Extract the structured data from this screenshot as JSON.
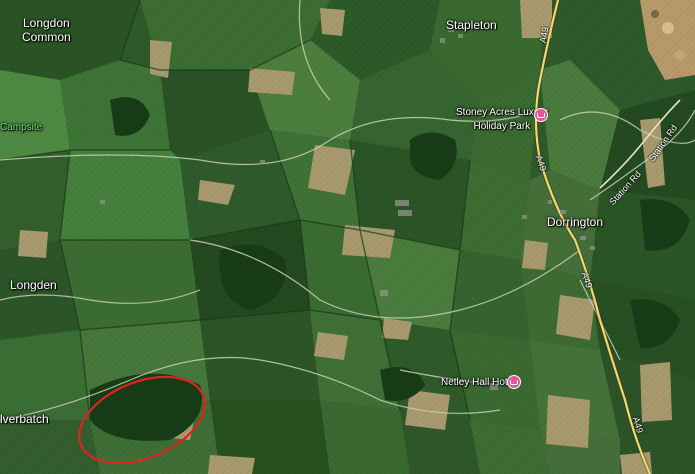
{
  "map": {
    "places": {
      "longdon_line1": "Longdon",
      "longdon_line2": "Common",
      "stapleton": "Stapleton",
      "dorrington": "Dorrington",
      "condover": "Longden",
      "campsite": "Campsite",
      "lverbatch": "lverbatch"
    },
    "pois": {
      "stoney_acres_line1": "Stoney Acres Luxury",
      "stoney_acres_line2": "Holiday Park",
      "netley_hall": "Netley Hall Hotel"
    },
    "roads": {
      "a49_top": "A49",
      "a49_mid": "A49",
      "a49_lower": "A49",
      "a49_bottom": "A49",
      "station_rd_top": "Station Rd",
      "station_rd_mid": "Station Rd"
    },
    "colors": {
      "field_dark": "#1f4a1f",
      "field_mid": "#3b6e32",
      "field_light": "#5b8a45",
      "field_tan": "#a89a6e",
      "road_major": "#f2d76b",
      "road_minor": "#c9d1b8",
      "hotel_pin": "#e0589a",
      "annotation_circle": "#e0231f",
      "label_green": "#6fe36f"
    },
    "icons": {
      "hotel": "hotel-bed-icon"
    }
  }
}
